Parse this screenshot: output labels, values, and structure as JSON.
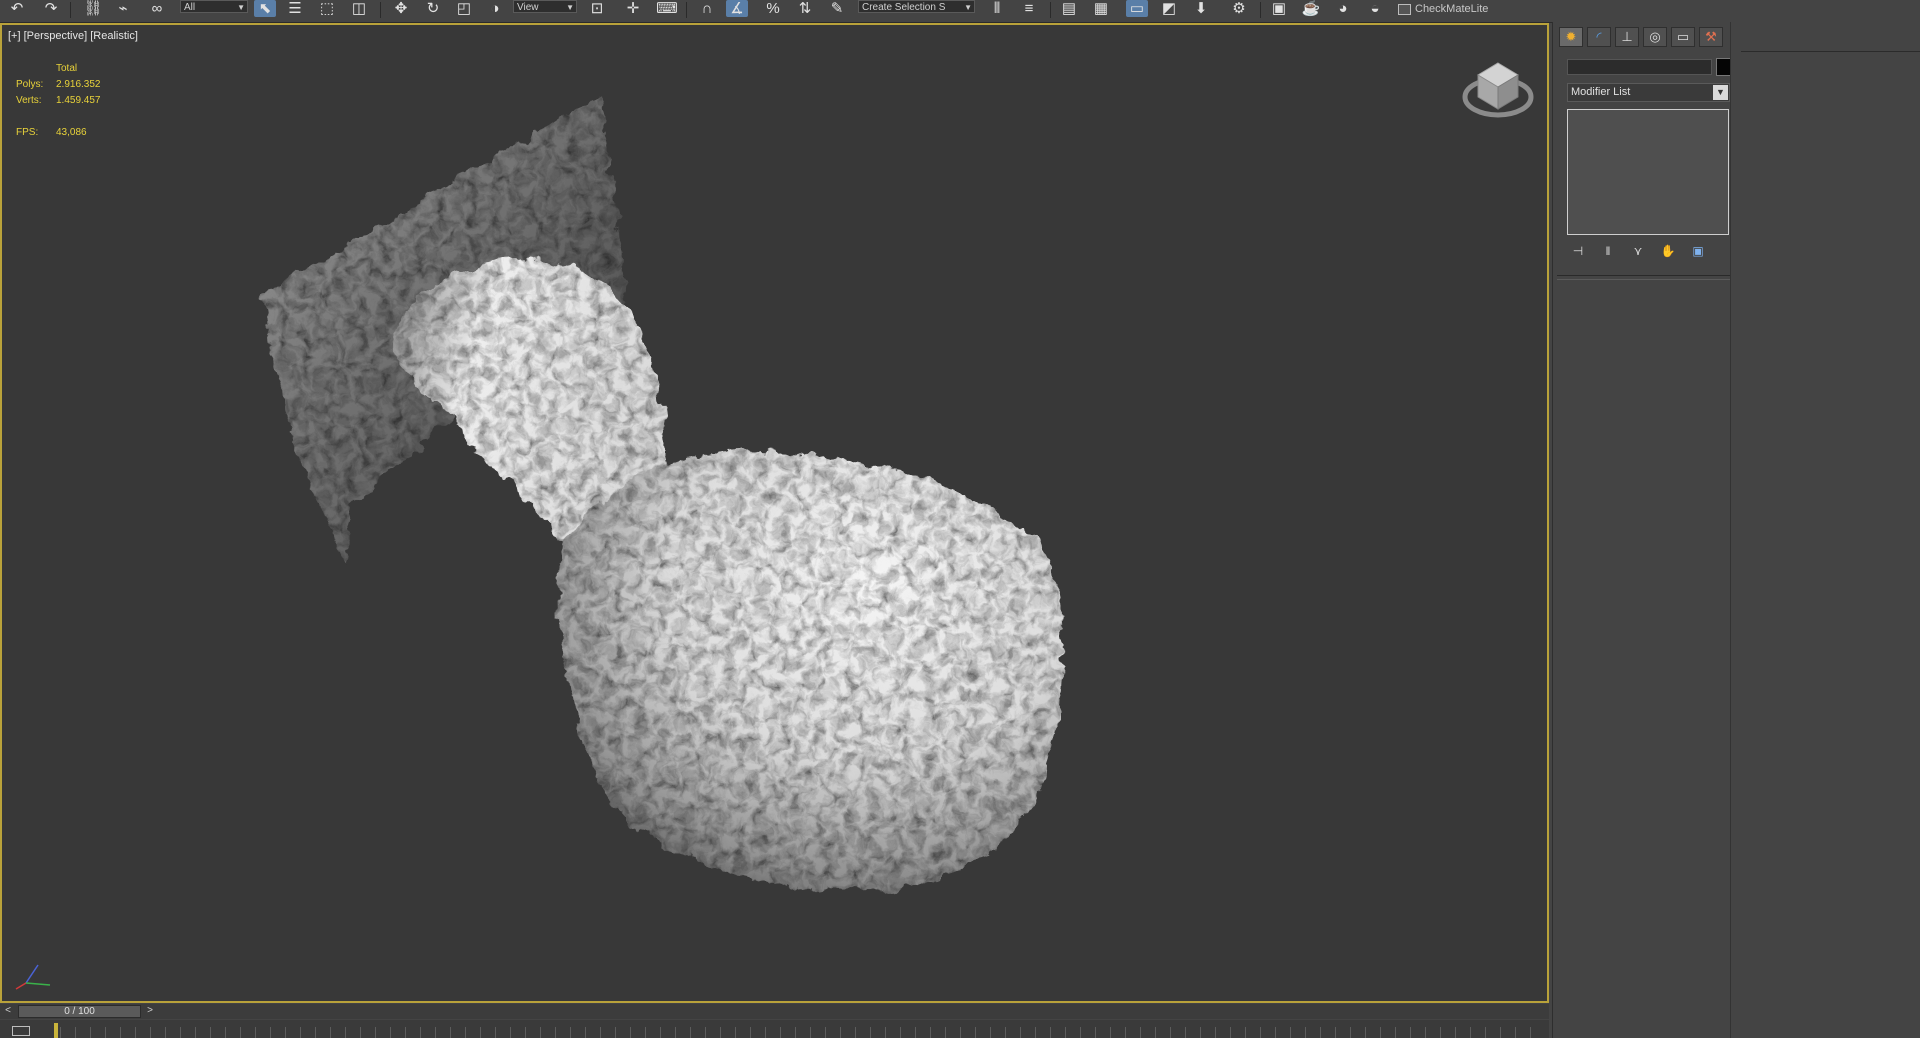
{
  "viewport": {
    "label": "[+] [Perspective] [Realistic]",
    "stats": {
      "total_label": "Total",
      "polys_label": "Polys:",
      "polys_value": "2.916.352",
      "verts_label": "Verts:",
      "verts_value": "1.459.457",
      "fps_label": "FPS:",
      "fps_value": "43,086"
    },
    "active_border_color": "#b9a23a"
  },
  "toolbar": {
    "selection_filter": "All",
    "reference_coord": "View",
    "named_selection": "Create Selection S",
    "plugin_label": "CheckMateLite",
    "icons": [
      "undo-icon",
      "redo-icon",
      "link-icon",
      "unlink-icon",
      "bind-space-warp-icon",
      "select-object-icon",
      "select-by-name-icon",
      "rect-selection-icon",
      "window-crossing-icon",
      "move-icon",
      "rotate-icon",
      "scale-icon",
      "place-icon",
      "pivot-icon",
      "snaps-icon",
      "angle-snap-icon",
      "percent-snap-icon",
      "spinner-snap-icon",
      "edit-named-selection-icon",
      "mirror-icon",
      "align-icon",
      "layer-explorer-icon",
      "ribbon-icon",
      "curve-editor-icon",
      "schematic-view-icon",
      "material-editor-icon",
      "render-setup-icon",
      "rendered-frame-icon",
      "render-icon",
      "render-production-icon"
    ]
  },
  "command_panel": {
    "tabs": [
      "create-tab",
      "modify-tab",
      "hierarchy-tab",
      "motion-tab",
      "display-tab",
      "utilities-tab"
    ],
    "active_tab": "create-tab",
    "object_name": "",
    "object_color": "#050505",
    "modifier_list": "Modifier List"
  },
  "time_slider": {
    "frame_display": "0 / 100",
    "prev": "<",
    "next": ">"
  }
}
